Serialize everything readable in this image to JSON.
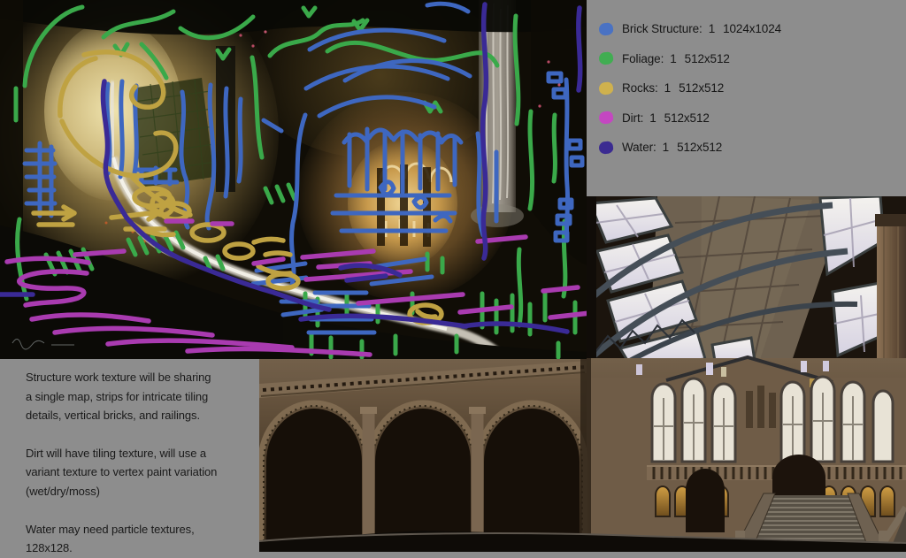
{
  "board": {
    "background_color": "#8d8d8d"
  },
  "legend": {
    "items": [
      {
        "label": "Brick Structure:",
        "count": "1",
        "size": "1024x1024",
        "color": "#4a72c3"
      },
      {
        "label": "Foliage:",
        "count": "1",
        "size": "512x512",
        "color": "#41ad52"
      },
      {
        "label": "Rocks:",
        "count": "1",
        "size": "512x512",
        "color": "#cfb14e"
      },
      {
        "label": "Dirt:",
        "count": "1",
        "size": "512x512",
        "color": "#c447c1"
      },
      {
        "label": "Water:",
        "count": "1",
        "size": "512x512",
        "color": "#3b2b91"
      }
    ]
  },
  "notes": {
    "paragraphs": [
      "Structure work texture will be sharing\na single map, strips for intricate tiling\ndetails, vertical bricks, and railings.",
      "Dirt will have tiling texture, will use a\nvariant texture to vertex paint variation\n(wet/dry/moss)",
      "Water may need particle textures,\n128x128."
    ]
  },
  "images": {
    "concept_art_name": "annotated-concept-painting",
    "reference_photo_name": "museum-interior-reference-photo"
  }
}
